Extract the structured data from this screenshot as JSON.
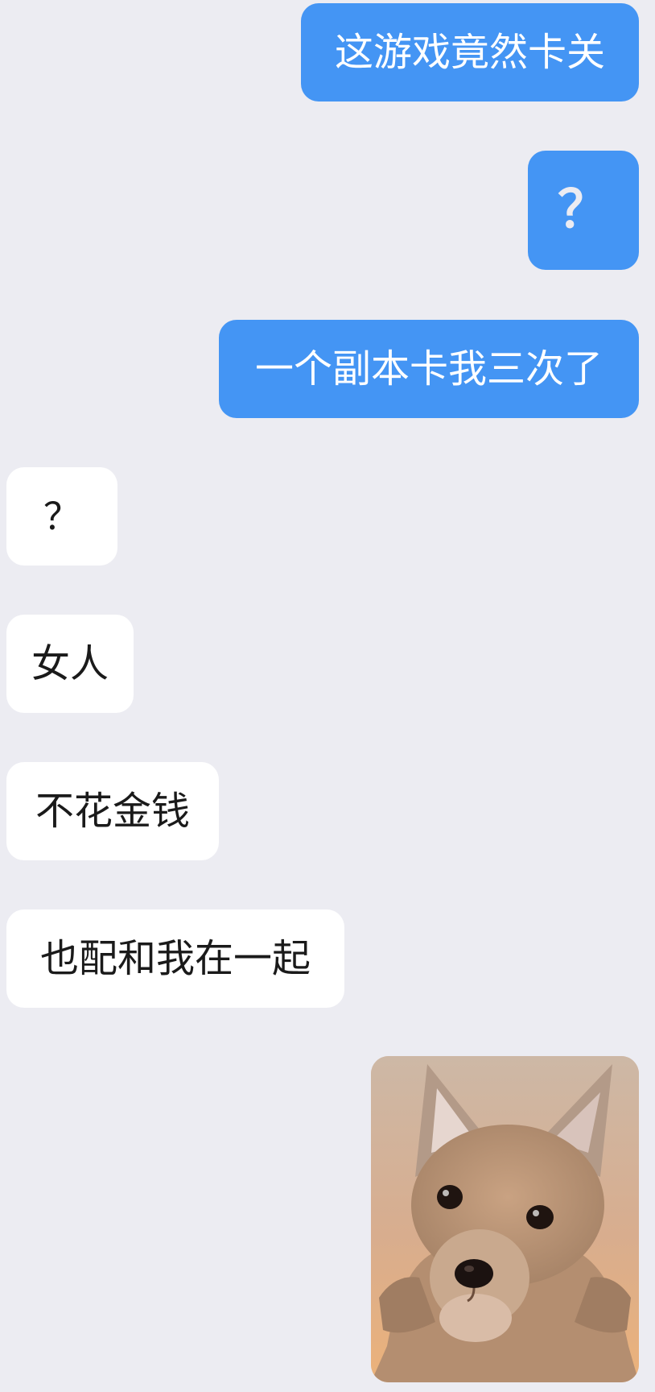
{
  "messages": [
    {
      "direction": "outgoing",
      "type": "text",
      "text": "这游戏竟然卡关"
    },
    {
      "direction": "outgoing",
      "type": "text",
      "text": "？"
    },
    {
      "direction": "outgoing",
      "type": "text",
      "text": "一个副本卡我三次了"
    },
    {
      "direction": "incoming",
      "type": "text",
      "text": "？"
    },
    {
      "direction": "incoming",
      "type": "text",
      "text": "女人"
    },
    {
      "direction": "incoming",
      "type": "text",
      "text": "不花金钱"
    },
    {
      "direction": "incoming",
      "type": "text",
      "text": "也配和我在一起"
    },
    {
      "direction": "outgoing",
      "type": "image",
      "image": "chihuahua-hands-on-hips-sticker"
    }
  ],
  "colors": {
    "background": "#ececf2",
    "outgoing_bubble": "#4495f4",
    "incoming_bubble": "#ffffff",
    "incoming_text": "#1a1a1a",
    "outgoing_text": "#ffffff"
  }
}
